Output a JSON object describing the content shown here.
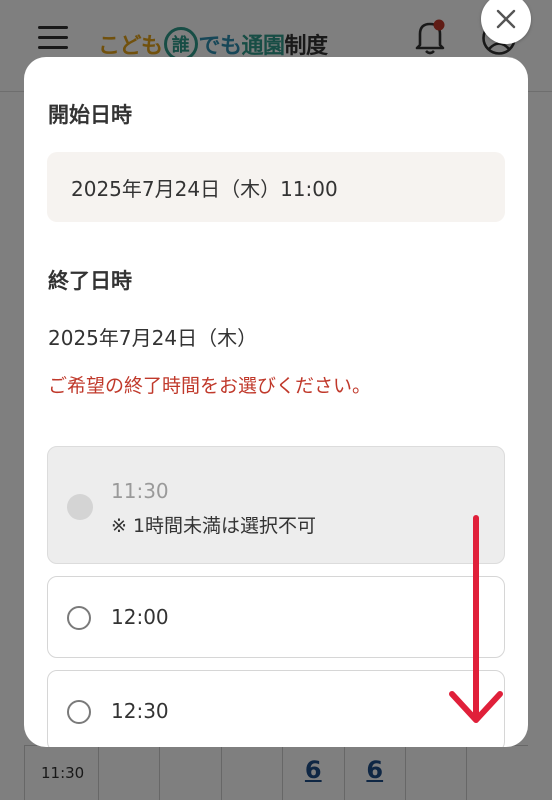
{
  "app_header": {
    "logo": {
      "part1": "こども",
      "circled": "誰",
      "part2": "でも",
      "part3": "通園",
      "part4": "制度"
    },
    "icons": [
      "menu-icon",
      "notification-bell-icon",
      "user-account-icon"
    ],
    "bell_badge_color": "#c0392b"
  },
  "background_table": {
    "time": "11:30",
    "cells": [
      "6",
      "6"
    ]
  },
  "modal": {
    "start_section": {
      "title": "開始日時",
      "value": "2025年7月24日（木）11:00"
    },
    "end_section": {
      "title": "終了日時",
      "date": "2025年7月24日（木）",
      "notice": "ご希望の終了時間をお選びください。"
    },
    "options": [
      {
        "time": "11:30",
        "note": "※ 1時間未満は選択不可",
        "disabled": true
      },
      {
        "time": "12:00",
        "disabled": false
      },
      {
        "time": "12:30",
        "disabled": false
      }
    ],
    "close_icon": "close-icon",
    "scroll_hint_icon": "down-arrow-icon",
    "scroll_hint_color": "#e0203a"
  }
}
